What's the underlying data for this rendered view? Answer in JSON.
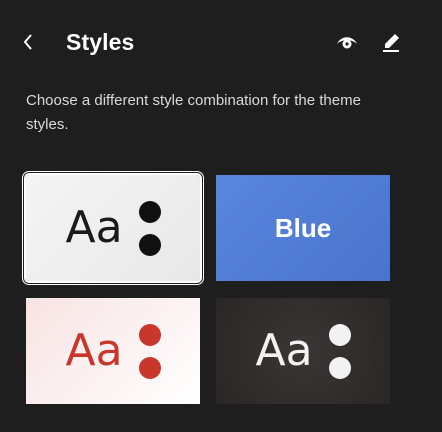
{
  "header": {
    "title": "Styles"
  },
  "description": "Choose a different style combination for the theme styles.",
  "styles": [
    {
      "label": "Aa",
      "accent": "#111111"
    },
    {
      "label": "Blue",
      "accent": "#5b86dd"
    },
    {
      "label": "Aa",
      "accent": "#c9362b"
    },
    {
      "label": "Aa",
      "accent": "#f2f2f2"
    }
  ],
  "icons": {
    "back": "chevron-left-icon",
    "preview": "eye-icon",
    "edit": "pencil-icon"
  },
  "colors": {
    "background": "#1e1e1e",
    "text": "#ffffff",
    "muted_text": "#d9d9d9"
  }
}
